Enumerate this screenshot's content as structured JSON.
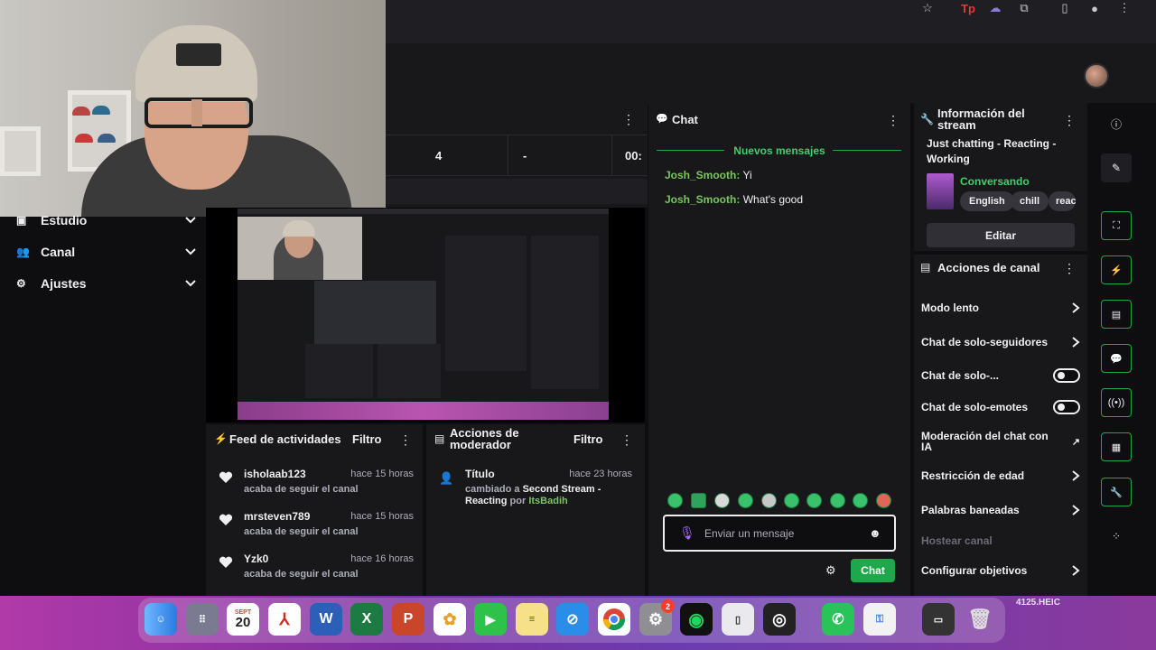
{
  "webcam": {},
  "nav": {
    "items": [
      {
        "label": "Estudio",
        "icon": "studio-icon"
      },
      {
        "label": "Canal",
        "icon": "people-icon"
      },
      {
        "label": "Ajustes",
        "icon": "gear-icon"
      }
    ]
  },
  "stats": {
    "values": [
      "4",
      "-",
      "00:"
    ]
  },
  "activity_feed": {
    "title": "Feed de actividades",
    "filter_label": "Filtro",
    "items": [
      {
        "user": "isholaab123",
        "time": "hace 15 horas",
        "action": "acaba de seguir el canal"
      },
      {
        "user": "mrsteven789",
        "time": "hace 15 horas",
        "action": "acaba de seguir el canal"
      },
      {
        "user": "Yzk0",
        "time": "hace 16 horas",
        "action": "acaba de seguir el canal"
      }
    ]
  },
  "mod_actions": {
    "title": "Acciones de moderador",
    "filter_label": "Filtro",
    "item": {
      "heading": "Título",
      "time": "hace 23 horas",
      "text_prefix": "cambiado a",
      "new_title": "Second Stream - Reacting",
      "by": "por",
      "moderator": "ItsBadih"
    }
  },
  "chat": {
    "title": "Chat",
    "new_messages": "Nuevos mensajes",
    "messages": [
      {
        "user": "Josh_Smooth:",
        "text": "Yi"
      },
      {
        "user": "Josh_Smooth:",
        "text": "What's good"
      }
    ],
    "input_placeholder": "Enviar un mensaje",
    "send_label": "Chat"
  },
  "stream_info": {
    "title": "Información del stream",
    "stream_title": "Just chatting - Reacting - Working",
    "category": "Conversando",
    "tags": [
      "English",
      "chill",
      "reac"
    ],
    "edit_label": "Editar"
  },
  "channel_actions": {
    "title": "Acciones de canal",
    "items": [
      {
        "label": "Modo lento",
        "control": "chevron"
      },
      {
        "label": "Chat de solo-seguidores",
        "control": "chevron"
      },
      {
        "label": "Chat de solo-...",
        "control": "toggle",
        "on": false
      },
      {
        "label": "Chat de solo-emotes",
        "control": "toggle",
        "on": false
      },
      {
        "label": "Moderación del chat con IA",
        "control": "external"
      },
      {
        "label": "Restricción de edad",
        "control": "chevron"
      },
      {
        "label": "Palabras baneadas",
        "control": "chevron"
      },
      {
        "label": "Hostear canal",
        "control": "none",
        "disabled": true
      },
      {
        "label": "Configurar objetivos",
        "control": "chevron"
      }
    ]
  },
  "dock": {
    "calendar_month": "SEPT",
    "calendar_day": "20",
    "badge_count": "2",
    "screenshot_label": "4125.HEIC"
  },
  "colors": {
    "accent_green": "#1fa84b",
    "chat_user": "#7ac55f",
    "panel_bg": "#18181b",
    "page_bg": "#0e0e10"
  }
}
